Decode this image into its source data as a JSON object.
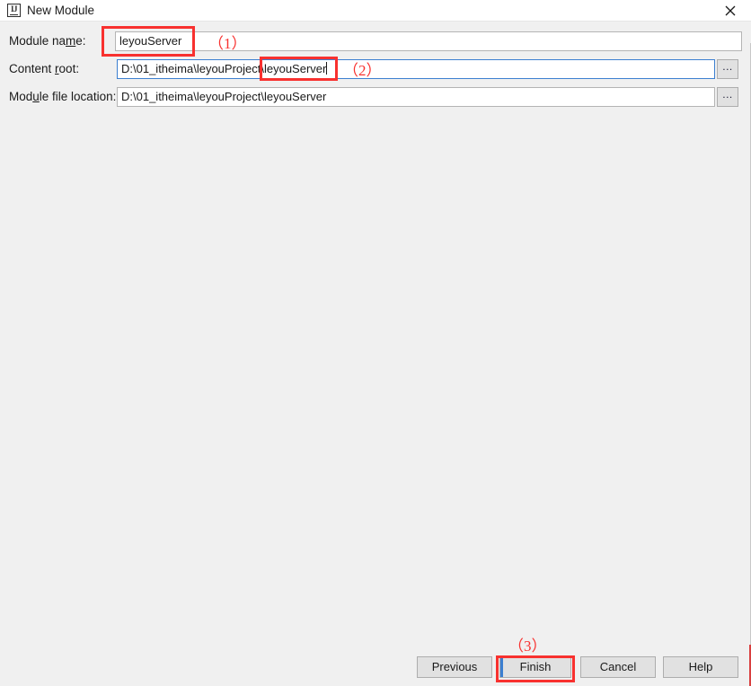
{
  "window": {
    "title": "New Module",
    "app_icon": "intellij-idea-icon",
    "icon_text": "IJ",
    "close_icon": "close-icon"
  },
  "form": {
    "fields": [
      {
        "id": "module-name",
        "label_before": "Module na",
        "label_mnemonic": "m",
        "label_after": "e:",
        "value": "leyouServer",
        "focused": false,
        "has_browse": false,
        "has_caret": false
      },
      {
        "id": "content-root",
        "label_before": "Content ",
        "label_mnemonic": "r",
        "label_after": "oot:",
        "value": "D:\\01_itheima\\leyouProject\\leyouServer",
        "focused": true,
        "has_browse": true,
        "has_caret": true
      },
      {
        "id": "file-location",
        "label_before": "Mod",
        "label_mnemonic": "u",
        "label_after": "le file location:",
        "value": "D:\\01_itheima\\leyouProject\\leyouServer",
        "focused": false,
        "has_browse": true,
        "has_caret": false
      }
    ],
    "browse_button_label": "...",
    "browse_button_name": "ellipsis-browse-icon"
  },
  "buttons": {
    "previous": "Previous",
    "finish": "Finish",
    "cancel": "Cancel",
    "help": "Help"
  },
  "annotations": {
    "accent_color": "#f8312f",
    "marks": [
      {
        "id": "1",
        "label": "（1）",
        "target": "module-name-input"
      },
      {
        "id": "2",
        "label": "（2）",
        "target": "content-root-suffix"
      },
      {
        "id": "3",
        "label": "（3）",
        "target": "finish-button"
      }
    ]
  }
}
